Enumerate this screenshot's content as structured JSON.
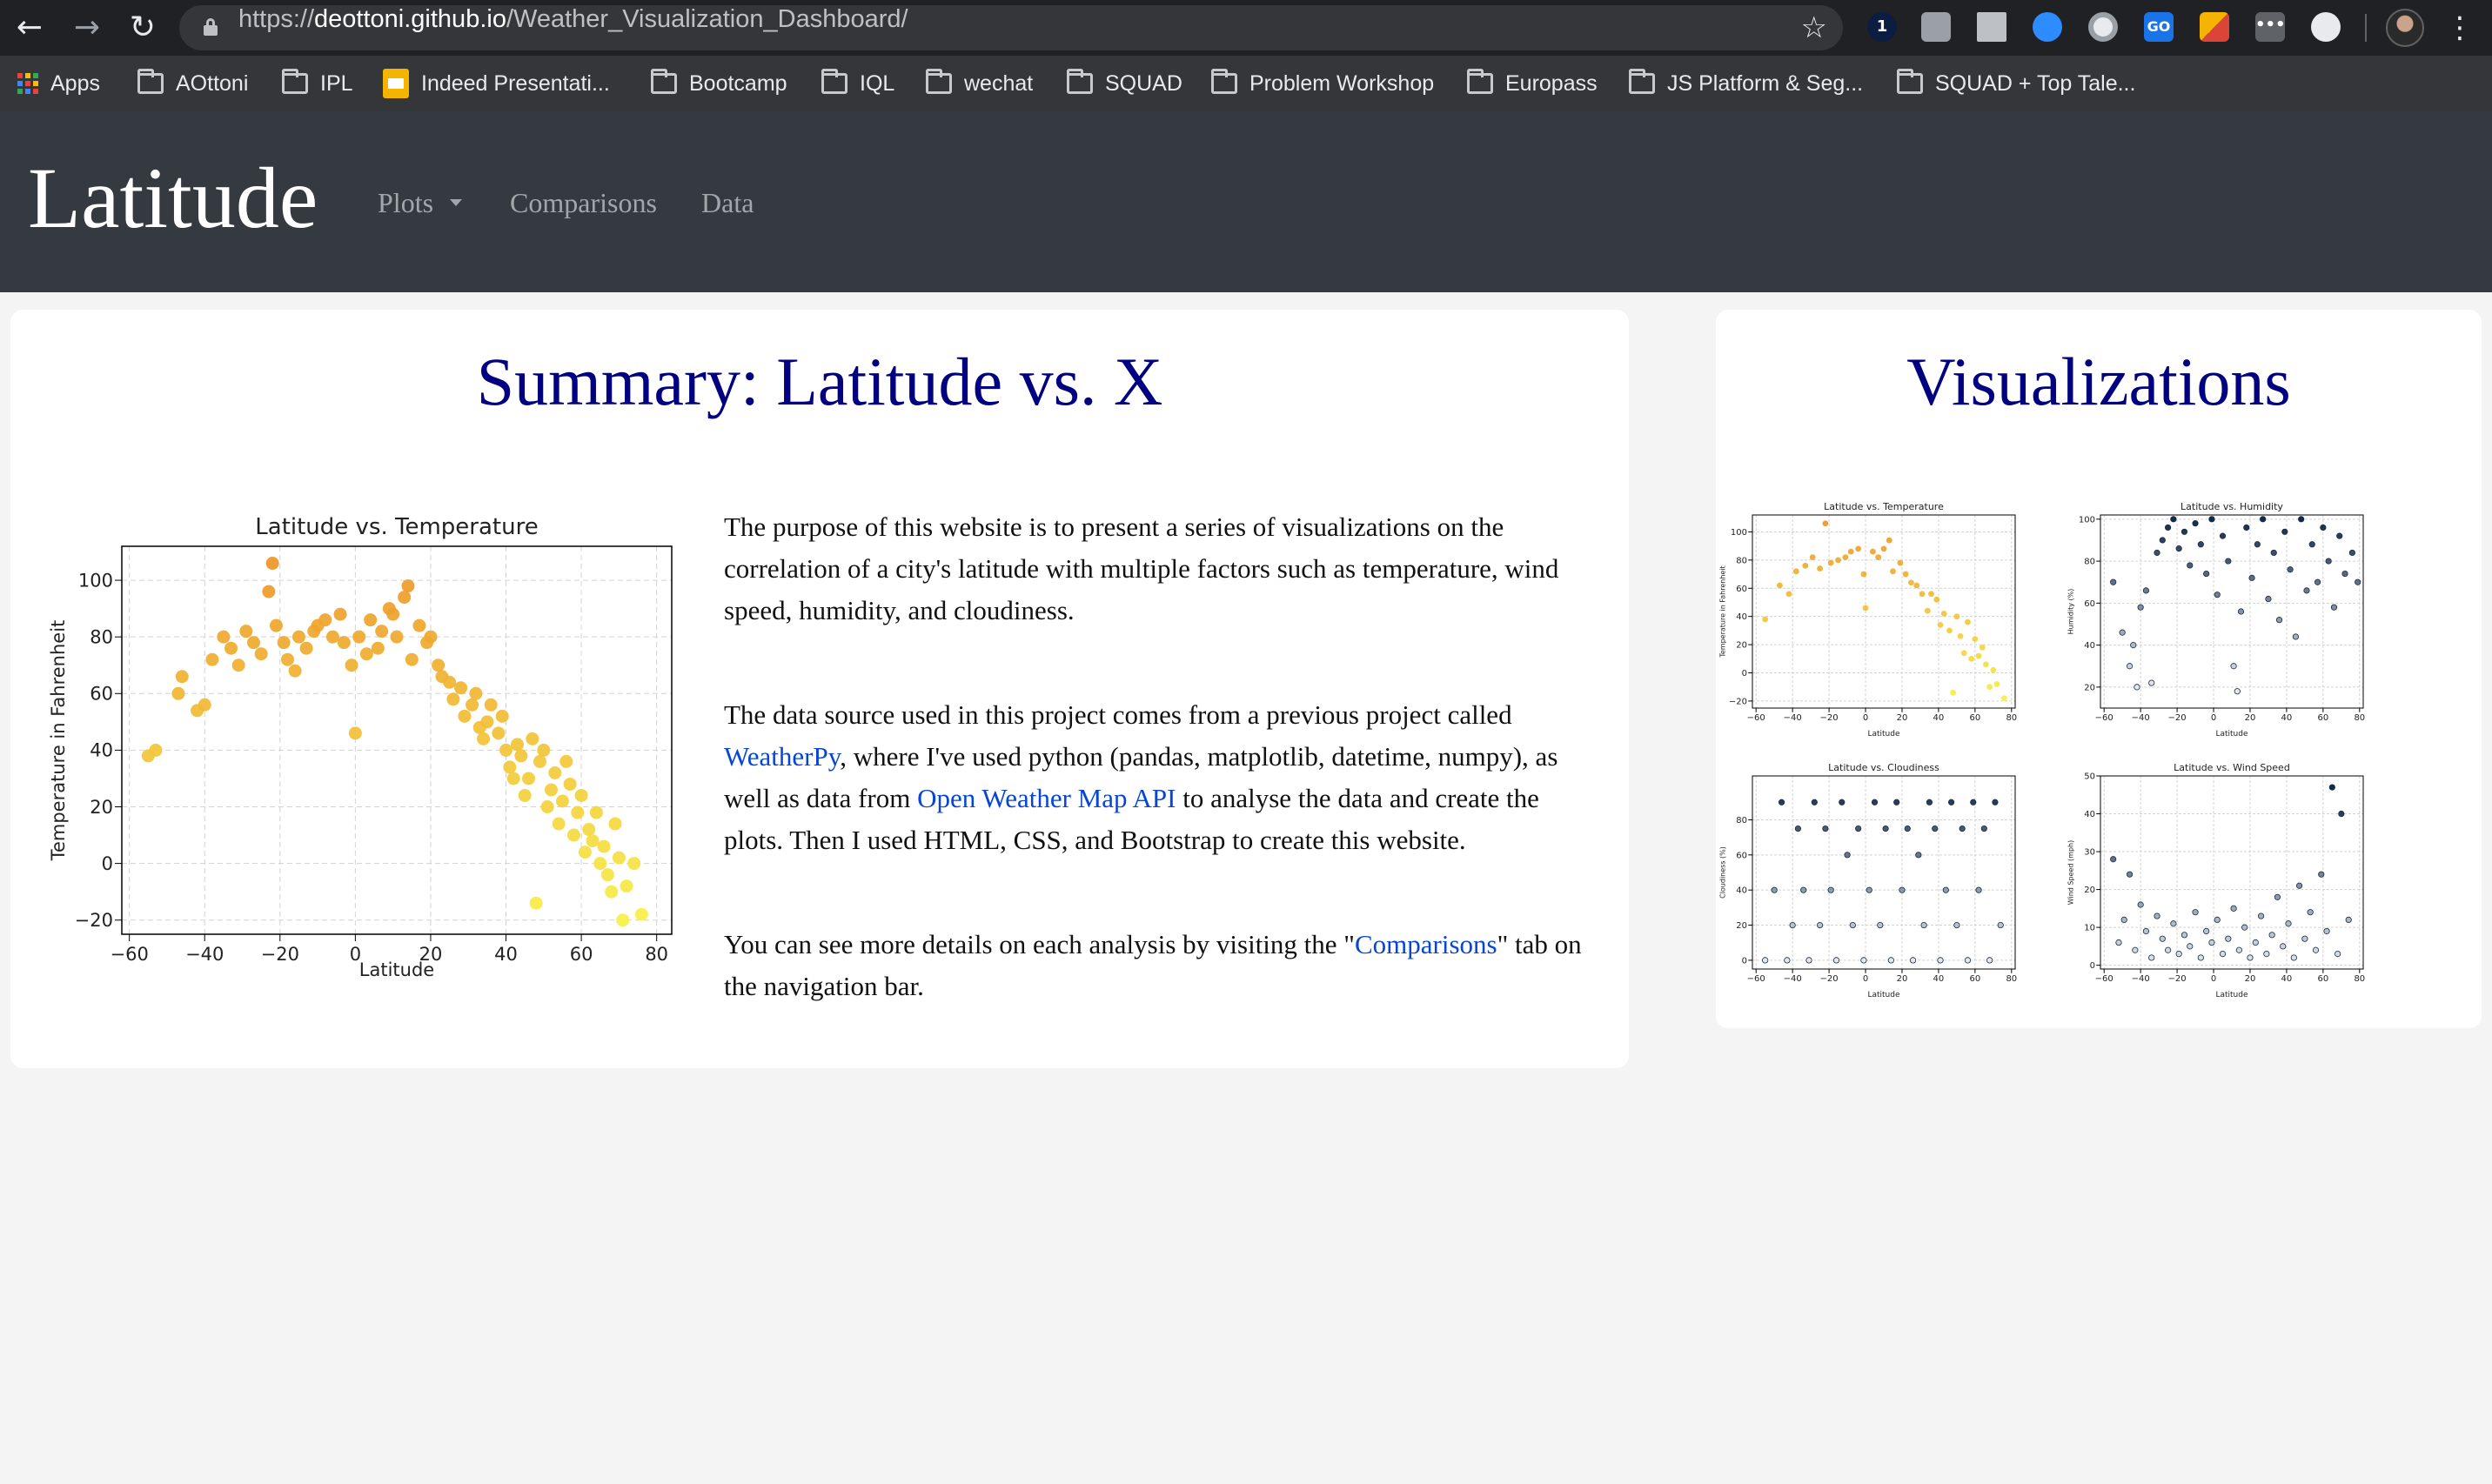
{
  "browser": {
    "url_scheme": "https://",
    "url_host": "deottoni.github.io",
    "url_path": "/Weather_Visualization_Dashboard/",
    "bookmarks": [
      "Apps",
      "AOttoni",
      "IPL",
      "Indeed Presentati...",
      "Bootcamp",
      "IQL",
      "wechat",
      "SQUAD",
      "Problem Workshop",
      "Europass",
      "JS Platform & Seg...",
      "SQUAD + Top Tale..."
    ]
  },
  "navbar": {
    "brand": "Latitude",
    "plots": "Plots",
    "comparisons": "Comparisons",
    "data": "Data"
  },
  "summary": {
    "title": "Summary: Latitude vs. X",
    "p1": "The purpose of this website is to present a series of visualizations on the correlation of a city's latitude with multiple factors such as temperature, wind speed, humidity, and cloudiness.",
    "p2_a": "The data source used in this project comes from a previous project called ",
    "p2_link1": "WeatherPy",
    "p2_b": ", where I've used python (pandas, matplotlib, datetime, numpy), as well as data from ",
    "p2_link2": "Open Weather Map API",
    "p2_c": " to analyse the data and create the plots. Then I used HTML, CSS, and Bootstrap to create this website.",
    "p3_a": "You can see more details on each analysis by visiting the \"",
    "p3_link": "Comparisons",
    "p3_b": "\" tab on the navigation bar."
  },
  "visualizations": {
    "title": "Visualizations"
  },
  "colors": {
    "brand_title": "#000080",
    "navbar_bg": "#343a40",
    "link": "#0645d6"
  },
  "chart_data": [
    {
      "type": "scatter",
      "title": "Latitude vs. Temperature",
      "xlabel": "Latitude",
      "ylabel": "Temperature in Fahrenheit",
      "xlim": [
        -62,
        84
      ],
      "ylim": [
        -25,
        112
      ],
      "xticks": [
        -60,
        -40,
        -20,
        0,
        20,
        40,
        60,
        80
      ],
      "yticks": [
        -20,
        0,
        20,
        40,
        60,
        80,
        100
      ],
      "grid": true,
      "points": [
        [
          -55,
          38
        ],
        [
          -53,
          40
        ],
        [
          -47,
          60
        ],
        [
          -46,
          66
        ],
        [
          -42,
          54
        ],
        [
          -40,
          56
        ],
        [
          -38,
          72
        ],
        [
          -35,
          80
        ],
        [
          -33,
          76
        ],
        [
          -31,
          70
        ],
        [
          -29,
          82
        ],
        [
          -27,
          78
        ],
        [
          -25,
          74
        ],
        [
          -23,
          96
        ],
        [
          -22,
          106
        ],
        [
          -21,
          84
        ],
        [
          -19,
          78
        ],
        [
          -18,
          72
        ],
        [
          -16,
          68
        ],
        [
          -15,
          80
        ],
        [
          -13,
          76
        ],
        [
          -11,
          82
        ],
        [
          -10,
          84
        ],
        [
          -8,
          86
        ],
        [
          -6,
          80
        ],
        [
          -4,
          88
        ],
        [
          -3,
          78
        ],
        [
          -1,
          70
        ],
        [
          0,
          46
        ],
        [
          1,
          80
        ],
        [
          3,
          74
        ],
        [
          4,
          86
        ],
        [
          6,
          76
        ],
        [
          7,
          82
        ],
        [
          9,
          90
        ],
        [
          10,
          88
        ],
        [
          11,
          80
        ],
        [
          13,
          94
        ],
        [
          14,
          98
        ],
        [
          15,
          72
        ],
        [
          17,
          84
        ],
        [
          19,
          78
        ],
        [
          20,
          80
        ],
        [
          22,
          70
        ],
        [
          23,
          66
        ],
        [
          25,
          64
        ],
        [
          26,
          58
        ],
        [
          28,
          62
        ],
        [
          29,
          52
        ],
        [
          31,
          56
        ],
        [
          32,
          60
        ],
        [
          33,
          48
        ],
        [
          34,
          44
        ],
        [
          35,
          50
        ],
        [
          36,
          56
        ],
        [
          38,
          46
        ],
        [
          39,
          52
        ],
        [
          40,
          40
        ],
        [
          41,
          34
        ],
        [
          42,
          30
        ],
        [
          43,
          42
        ],
        [
          44,
          38
        ],
        [
          45,
          24
        ],
        [
          46,
          30
        ],
        [
          47,
          44
        ],
        [
          48,
          -14
        ],
        [
          49,
          36
        ],
        [
          50,
          40
        ],
        [
          51,
          20
        ],
        [
          52,
          26
        ],
        [
          53,
          32
        ],
        [
          54,
          14
        ],
        [
          55,
          22
        ],
        [
          56,
          36
        ],
        [
          57,
          28
        ],
        [
          58,
          10
        ],
        [
          59,
          18
        ],
        [
          60,
          24
        ],
        [
          61,
          4
        ],
        [
          62,
          12
        ],
        [
          63,
          8
        ],
        [
          64,
          18
        ],
        [
          65,
          0
        ],
        [
          66,
          6
        ],
        [
          67,
          -4
        ],
        [
          68,
          -10
        ],
        [
          69,
          14
        ],
        [
          70,
          2
        ],
        [
          71,
          -20
        ],
        [
          72,
          -8
        ],
        [
          74,
          0
        ],
        [
          76,
          -18
        ]
      ]
    },
    {
      "type": "scatter",
      "title": "Latitude vs. Temperature",
      "xlabel": "Latitude",
      "ylabel": "Temperature in Fahrenheit",
      "xlim": [
        -62,
        82
      ],
      "ylim": [
        -25,
        112
      ],
      "xticks": [
        -60,
        -40,
        -20,
        0,
        20,
        40,
        60,
        80
      ],
      "yticks": [
        -20,
        0,
        20,
        40,
        60,
        80,
        100
      ],
      "grid": true,
      "points": [
        [
          -55,
          38
        ],
        [
          -47,
          62
        ],
        [
          -42,
          56
        ],
        [
          -38,
          72
        ],
        [
          -33,
          76
        ],
        [
          -29,
          82
        ],
        [
          -25,
          74
        ],
        [
          -22,
          106
        ],
        [
          -19,
          78
        ],
        [
          -15,
          80
        ],
        [
          -11,
          82
        ],
        [
          -8,
          86
        ],
        [
          -4,
          88
        ],
        [
          -1,
          70
        ],
        [
          0,
          46
        ],
        [
          4,
          86
        ],
        [
          7,
          82
        ],
        [
          10,
          88
        ],
        [
          13,
          94
        ],
        [
          15,
          72
        ],
        [
          19,
          78
        ],
        [
          22,
          70
        ],
        [
          25,
          64
        ],
        [
          28,
          62
        ],
        [
          31,
          56
        ],
        [
          34,
          44
        ],
        [
          36,
          56
        ],
        [
          39,
          52
        ],
        [
          41,
          34
        ],
        [
          43,
          42
        ],
        [
          46,
          30
        ],
        [
          48,
          -14
        ],
        [
          50,
          40
        ],
        [
          52,
          26
        ],
        [
          54,
          14
        ],
        [
          56,
          36
        ],
        [
          58,
          10
        ],
        [
          60,
          24
        ],
        [
          62,
          12
        ],
        [
          64,
          18
        ],
        [
          66,
          6
        ],
        [
          68,
          -10
        ],
        [
          70,
          2
        ],
        [
          72,
          -8
        ],
        [
          76,
          -18
        ]
      ]
    },
    {
      "type": "scatter",
      "title": "Latitude vs. Humidity",
      "xlabel": "Latitude",
      "ylabel": "Humidity (%)",
      "xlim": [
        -62,
        82
      ],
      "ylim": [
        10,
        102
      ],
      "xticks": [
        -60,
        -40,
        -20,
        0,
        20,
        40,
        60,
        80
      ],
      "yticks": [
        20,
        40,
        60,
        80,
        100
      ],
      "grid": true,
      "points": [
        [
          -55,
          70
        ],
        [
          -50,
          46
        ],
        [
          -46,
          30
        ],
        [
          -44,
          40
        ],
        [
          -42,
          20
        ],
        [
          -40,
          58
        ],
        [
          -37,
          66
        ],
        [
          -34,
          22
        ],
        [
          -31,
          84
        ],
        [
          -28,
          90
        ],
        [
          -25,
          96
        ],
        [
          -22,
          100
        ],
        [
          -19,
          86
        ],
        [
          -16,
          94
        ],
        [
          -13,
          78
        ],
        [
          -10,
          98
        ],
        [
          -7,
          88
        ],
        [
          -4,
          74
        ],
        [
          -1,
          100
        ],
        [
          2,
          64
        ],
        [
          5,
          92
        ],
        [
          8,
          80
        ],
        [
          11,
          30
        ],
        [
          13,
          18
        ],
        [
          15,
          56
        ],
        [
          18,
          96
        ],
        [
          21,
          72
        ],
        [
          24,
          88
        ],
        [
          27,
          100
        ],
        [
          30,
          62
        ],
        [
          33,
          84
        ],
        [
          36,
          52
        ],
        [
          39,
          94
        ],
        [
          42,
          76
        ],
        [
          45,
          44
        ],
        [
          48,
          100
        ],
        [
          51,
          66
        ],
        [
          54,
          88
        ],
        [
          57,
          70
        ],
        [
          60,
          96
        ],
        [
          63,
          80
        ],
        [
          66,
          58
        ],
        [
          69,
          92
        ],
        [
          72,
          74
        ],
        [
          76,
          84
        ],
        [
          79,
          70
        ]
      ]
    },
    {
      "type": "scatter",
      "title": "Latitude vs. Cloudiness",
      "xlabel": "Latitude",
      "ylabel": "Cloudiness (%)",
      "xlim": [
        -62,
        82
      ],
      "ylim": [
        -5,
        105
      ],
      "xticks": [
        -60,
        -40,
        -20,
        0,
        20,
        40,
        60,
        80
      ],
      "yticks": [
        0,
        20,
        40,
        60,
        80
      ],
      "grid": true,
      "points": [
        [
          -55,
          0
        ],
        [
          -50,
          40
        ],
        [
          -46,
          90
        ],
        [
          -43,
          0
        ],
        [
          -40,
          20
        ],
        [
          -37,
          75
        ],
        [
          -34,
          40
        ],
        [
          -31,
          0
        ],
        [
          -28,
          90
        ],
        [
          -25,
          20
        ],
        [
          -22,
          75
        ],
        [
          -19,
          40
        ],
        [
          -16,
          0
        ],
        [
          -13,
          90
        ],
        [
          -10,
          60
        ],
        [
          -7,
          20
        ],
        [
          -4,
          75
        ],
        [
          -1,
          0
        ],
        [
          2,
          40
        ],
        [
          5,
          90
        ],
        [
          8,
          20
        ],
        [
          11,
          75
        ],
        [
          14,
          0
        ],
        [
          17,
          90
        ],
        [
          20,
          40
        ],
        [
          23,
          75
        ],
        [
          26,
          0
        ],
        [
          29,
          60
        ],
        [
          32,
          20
        ],
        [
          35,
          90
        ],
        [
          38,
          75
        ],
        [
          41,
          0
        ],
        [
          44,
          40
        ],
        [
          47,
          90
        ],
        [
          50,
          20
        ],
        [
          53,
          75
        ],
        [
          56,
          0
        ],
        [
          59,
          90
        ],
        [
          62,
          40
        ],
        [
          65,
          75
        ],
        [
          68,
          0
        ],
        [
          71,
          90
        ],
        [
          74,
          20
        ]
      ]
    },
    {
      "type": "scatter",
      "title": "Latitude vs. Wind Speed",
      "xlabel": "Latitude",
      "ylabel": "Wind Speed (mph)",
      "xlim": [
        -62,
        82
      ],
      "ylim": [
        -1,
        50
      ],
      "xticks": [
        -60,
        -40,
        -20,
        0,
        20,
        40,
        60,
        80
      ],
      "yticks": [
        0,
        10,
        20,
        30,
        40,
        50
      ],
      "grid": true,
      "points": [
        [
          -55,
          28
        ],
        [
          -52,
          6
        ],
        [
          -49,
          12
        ],
        [
          -46,
          24
        ],
        [
          -43,
          4
        ],
        [
          -40,
          16
        ],
        [
          -37,
          9
        ],
        [
          -34,
          2
        ],
        [
          -31,
          13
        ],
        [
          -28,
          7
        ],
        [
          -25,
          4
        ],
        [
          -22,
          11
        ],
        [
          -19,
          3
        ],
        [
          -16,
          8
        ],
        [
          -13,
          5
        ],
        [
          -10,
          14
        ],
        [
          -7,
          2
        ],
        [
          -4,
          9
        ],
        [
          -1,
          6
        ],
        [
          2,
          12
        ],
        [
          5,
          3
        ],
        [
          8,
          7
        ],
        [
          11,
          15
        ],
        [
          14,
          4
        ],
        [
          17,
          10
        ],
        [
          20,
          2
        ],
        [
          23,
          6
        ],
        [
          26,
          13
        ],
        [
          29,
          3
        ],
        [
          32,
          8
        ],
        [
          35,
          18
        ],
        [
          38,
          5
        ],
        [
          41,
          11
        ],
        [
          44,
          2
        ],
        [
          47,
          21
        ],
        [
          50,
          7
        ],
        [
          53,
          14
        ],
        [
          56,
          4
        ],
        [
          59,
          24
        ],
        [
          62,
          9
        ],
        [
          65,
          47
        ],
        [
          68,
          3
        ],
        [
          70,
          40
        ],
        [
          74,
          12
        ]
      ]
    }
  ]
}
